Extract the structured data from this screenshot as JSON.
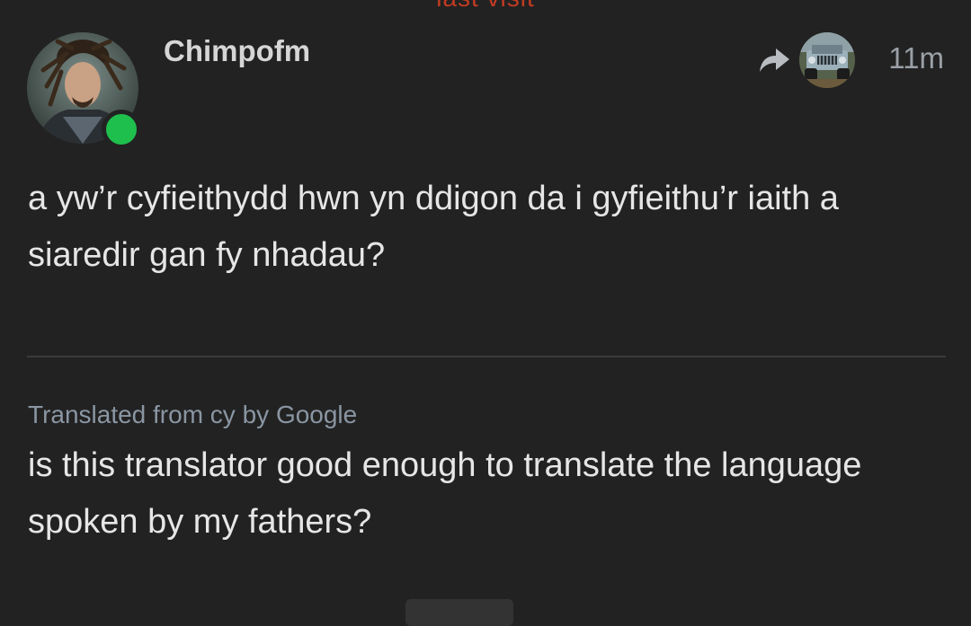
{
  "banner": {
    "last_visit": "last visit"
  },
  "post": {
    "username": "Chimpofm",
    "timestamp": "11m",
    "online": true,
    "text": "a yw’r cyfieithydd hwn yn ddigon da i gyfieithu’r iaith a siaredir gan fy nhadau?",
    "reply_icon": "reply-arrow-icon",
    "translation": {
      "note": "Translated from cy by Google",
      "text": "is this translator good enough to translate the language spoken by my fathers?"
    }
  },
  "colors": {
    "background": "#222222",
    "accent_red": "#c23b22",
    "online_green": "#1fbf4e",
    "muted_text": "#8a96a3"
  }
}
